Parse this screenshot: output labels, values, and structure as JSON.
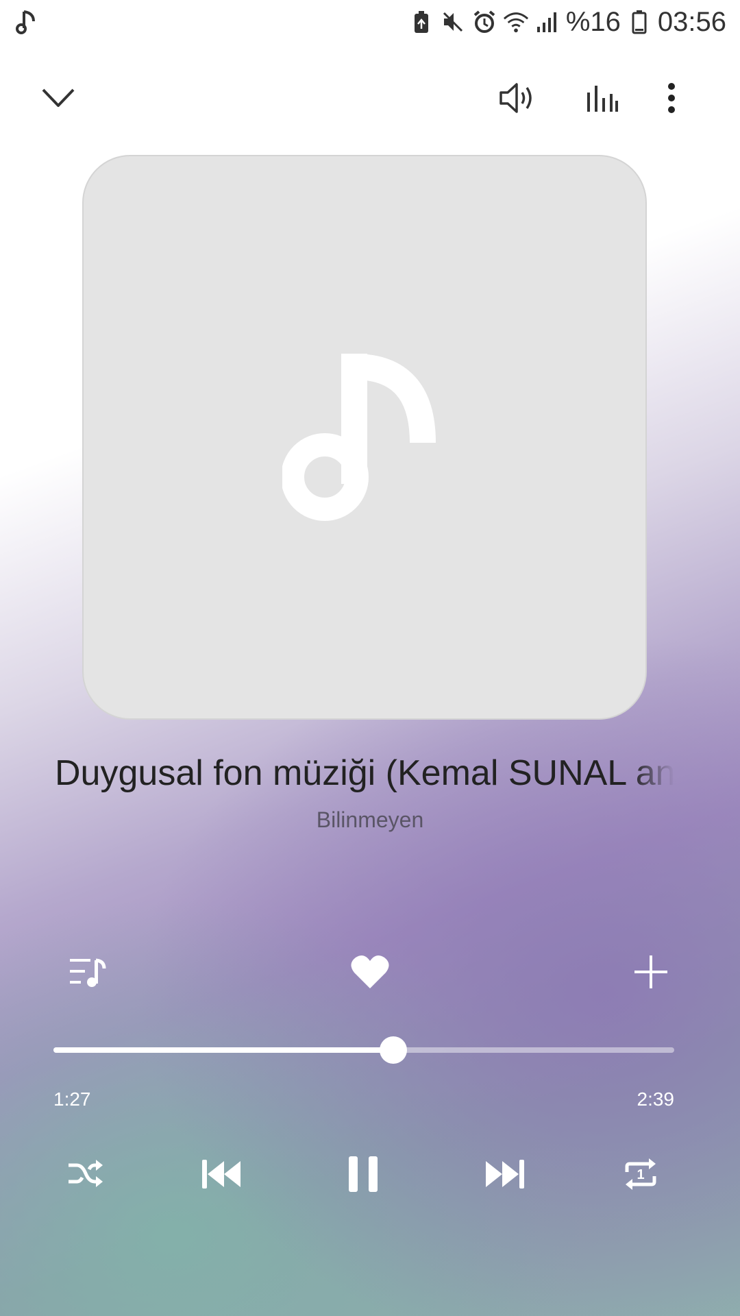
{
  "status_bar": {
    "left_icons": [
      "music-note-icon"
    ],
    "right_icons": [
      "battery-saver-icon",
      "mute-icon",
      "alarm-icon",
      "wifi-icon",
      "signal-icon"
    ],
    "battery_text": "%16",
    "time": "03:56"
  },
  "toolbar": {
    "icons": [
      "chevron-down-icon",
      "volume-icon",
      "equalizer-icon",
      "more-vert-icon"
    ]
  },
  "track": {
    "title": "Duygusal fon müziği (Kemal SUNAL anı",
    "artist": "Bilinmeyen"
  },
  "actions": {
    "icons": [
      "queue-music-icon",
      "heart-icon",
      "add-icon"
    ]
  },
  "progress": {
    "elapsed": "1:27",
    "total": "2:39",
    "fraction": 0.547
  },
  "controls": {
    "icons": [
      "shuffle-icon",
      "skip-previous-icon",
      "pause-icon",
      "skip-next-icon",
      "repeat-one-icon"
    ]
  },
  "colors": {
    "accent": "#ffffff",
    "album_bg": "#e4e4e4",
    "title_text": "#222222",
    "artist_text": "#5a5566"
  }
}
